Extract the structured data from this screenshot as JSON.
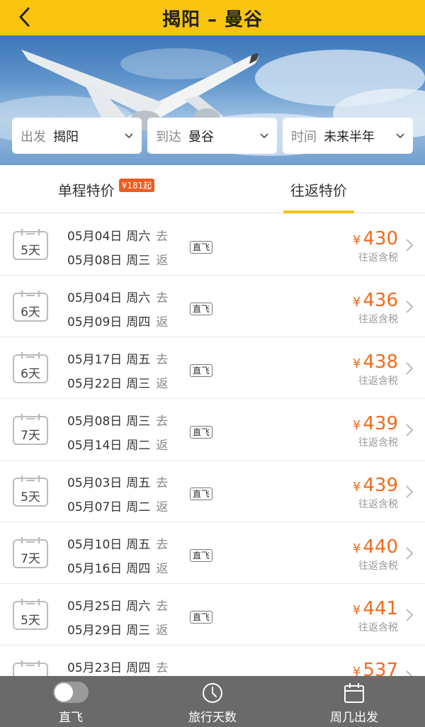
{
  "header": {
    "title": "揭阳 – 曼谷"
  },
  "filters": [
    {
      "key": "出发",
      "value": "揭阳"
    },
    {
      "key": "到达",
      "value": "曼谷"
    },
    {
      "key": "时间",
      "value": "未来半年"
    }
  ],
  "tabs": [
    {
      "label": "单程特价",
      "badge": "¥181起"
    },
    {
      "label": "往返特价"
    }
  ],
  "rows": [
    {
      "days": "5天",
      "out_date": "05月04日",
      "out_week": "周六",
      "out_dir": "去",
      "ret_date": "05月08日",
      "ret_week": "周三",
      "ret_dir": "返",
      "tag": "直飞",
      "currency": "¥",
      "price": "430",
      "price_note": "往返含税"
    },
    {
      "days": "6天",
      "out_date": "05月04日",
      "out_week": "周六",
      "out_dir": "去",
      "ret_date": "05月09日",
      "ret_week": "周四",
      "ret_dir": "返",
      "tag": "直飞",
      "currency": "¥",
      "price": "436",
      "price_note": "往返含税"
    },
    {
      "days": "6天",
      "out_date": "05月17日",
      "out_week": "周五",
      "out_dir": "去",
      "ret_date": "05月22日",
      "ret_week": "周三",
      "ret_dir": "返",
      "tag": "直飞",
      "currency": "¥",
      "price": "438",
      "price_note": "往返含税"
    },
    {
      "days": "7天",
      "out_date": "05月08日",
      "out_week": "周三",
      "out_dir": "去",
      "ret_date": "05月14日",
      "ret_week": "周二",
      "ret_dir": "返",
      "tag": "直飞",
      "currency": "¥",
      "price": "439",
      "price_note": "往返含税"
    },
    {
      "days": "5天",
      "out_date": "05月03日",
      "out_week": "周五",
      "out_dir": "去",
      "ret_date": "05月07日",
      "ret_week": "周二",
      "ret_dir": "返",
      "tag": "直飞",
      "currency": "¥",
      "price": "439",
      "price_note": "往返含税"
    },
    {
      "days": "7天",
      "out_date": "05月10日",
      "out_week": "周五",
      "out_dir": "去",
      "ret_date": "05月16日",
      "ret_week": "周四",
      "ret_dir": "返",
      "tag": "直飞",
      "currency": "¥",
      "price": "440",
      "price_note": "往返含税"
    },
    {
      "days": "5天",
      "out_date": "05月25日",
      "out_week": "周六",
      "out_dir": "去",
      "ret_date": "05月29日",
      "ret_week": "周三",
      "ret_dir": "返",
      "tag": "直飞",
      "currency": "¥",
      "price": "441",
      "price_note": "往返含税"
    },
    {
      "days": "",
      "out_date": "05月23日",
      "out_week": "周四",
      "out_dir": "去",
      "ret_date": "",
      "ret_week": "",
      "ret_dir": "",
      "tag": "",
      "currency": "¥",
      "price": "537",
      "price_note": ""
    }
  ],
  "bottom_bar": [
    {
      "label": "直飞",
      "icon": "toggle-switch"
    },
    {
      "label": "旅行天数",
      "icon": "clock-icon"
    },
    {
      "label": "周几出发",
      "icon": "calendar-icon"
    }
  ],
  "colors": {
    "header": "#f8c40e",
    "price": "#f26a1b",
    "badge": "#f25a1f",
    "bottom_bar": "#6a6a6a"
  }
}
